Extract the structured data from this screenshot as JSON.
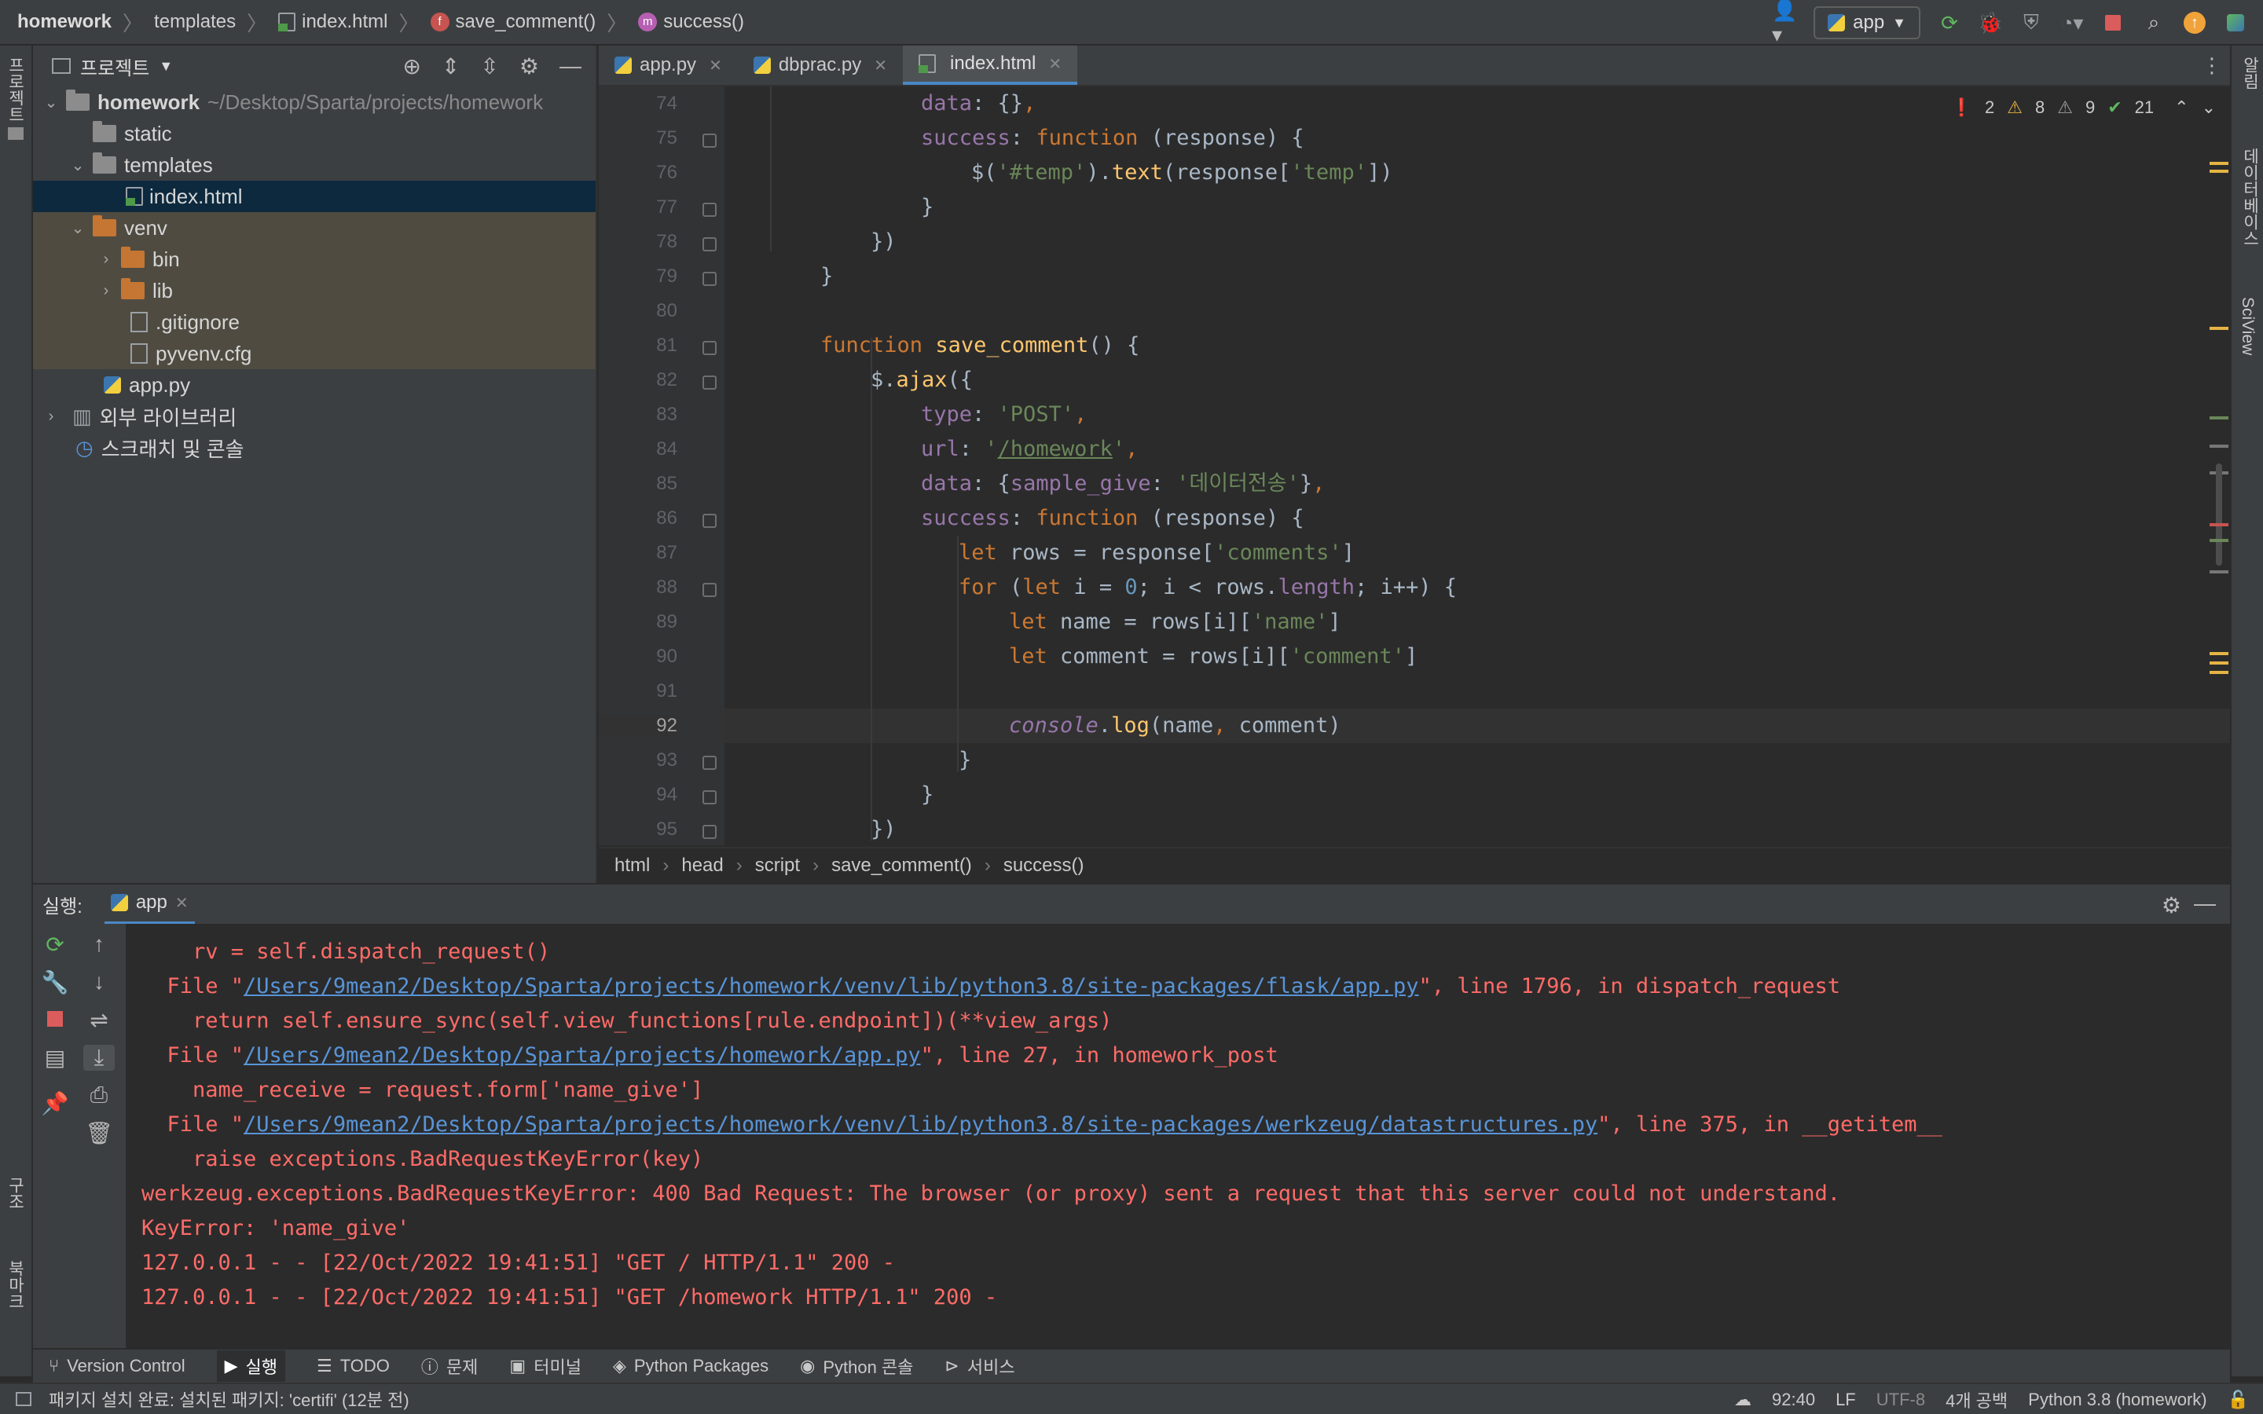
{
  "navbar": {
    "breadcrumb": [
      "homework",
      "templates",
      "index.html",
      "save_comment()",
      "success()"
    ],
    "run_config": "app"
  },
  "left_strip": {
    "project_label": "프로젝트",
    "structure_label": "구조",
    "bookmarks_label": "북마크"
  },
  "right_strip": {
    "notifications_label": "알림",
    "database_label": "데이터베이스",
    "sciview_label": "SciView"
  },
  "project": {
    "title": "프로젝트",
    "tree": [
      {
        "label": "homework",
        "hint": "~/Desktop/Sparta/projects/homework"
      },
      {
        "label": "static"
      },
      {
        "label": "templates"
      },
      {
        "label": "index.html"
      },
      {
        "label": "venv"
      },
      {
        "label": "bin"
      },
      {
        "label": "lib"
      },
      {
        "label": ".gitignore"
      },
      {
        "label": "pyvenv.cfg"
      },
      {
        "label": "app.py"
      },
      {
        "label": "외부 라이브러리"
      },
      {
        "label": "스크래치 및 콘솔"
      }
    ]
  },
  "tabs": [
    {
      "label": "app.py"
    },
    {
      "label": "dbprac.py"
    },
    {
      "label": "index.html"
    }
  ],
  "inspections": {
    "errors": "2",
    "warnings": "8",
    "weak_warnings": "9",
    "ok": "21"
  },
  "editor": {
    "line_numbers": [
      "74",
      "75",
      "76",
      "77",
      "78",
      "79",
      "80",
      "81",
      "82",
      "83",
      "84",
      "85",
      "86",
      "87",
      "88",
      "89",
      "90",
      "91",
      "92",
      "93",
      "94",
      "95"
    ],
    "current_line": "92"
  },
  "editor_breadcrumb": [
    "html",
    "head",
    "script",
    "save_comment()",
    "success()"
  ],
  "run": {
    "label": "실행:",
    "tab": "app",
    "console": [
      "    rv = self.dispatch_request()",
      "  File \"",
      "/Users/9mean2/Desktop/Sparta/projects/homework/venv/lib/python3.8/site-packages/flask/app.py",
      "\", line 1796, in dispatch_request",
      "    return self.ensure_sync(self.view_functions[rule.endpoint])(**view_args)",
      "/Users/9mean2/Desktop/Sparta/projects/homework/app.py",
      "\", line 27, in homework_post",
      "    name_receive = request.form['name_give']",
      "/Users/9mean2/Desktop/Sparta/projects/homework/venv/lib/python3.8/site-packages/werkzeug/datastructures.py",
      "\", line 375, in __getitem__",
      "    raise exceptions.BadRequestKeyError(key)",
      "werkzeug.exceptions.BadRequestKeyError: 400 Bad Request: The browser (or proxy) sent a request that this server could not understand.",
      "KeyError: 'name_give'",
      "127.0.0.1 - - [22/Oct/2022 19:41:51] \"GET / HTTP/1.1\" 200 -",
      "127.0.0.1 - - [22/Oct/2022 19:41:51] \"GET /homework HTTP/1.1\" 200 -"
    ]
  },
  "tool_windows": [
    "Version Control",
    "실행",
    "TODO",
    "문제",
    "터미널",
    "Python Packages",
    "Python 콘솔",
    "서비스"
  ],
  "status": {
    "message": "패키지 설치 완료: 설치된 패키지: 'certifi' (12분 전)",
    "position": "92:40",
    "line_sep": "LF",
    "encoding": "UTF-8",
    "indent": "4개 공백",
    "interpreter": "Python 3.8 (homework)"
  },
  "colors": {
    "accent": "#4a88c7",
    "error": "#ff6b68",
    "link": "#5894d8",
    "keyword": "#cc7832",
    "string": "#6a8759",
    "function": "#ffc66d"
  }
}
